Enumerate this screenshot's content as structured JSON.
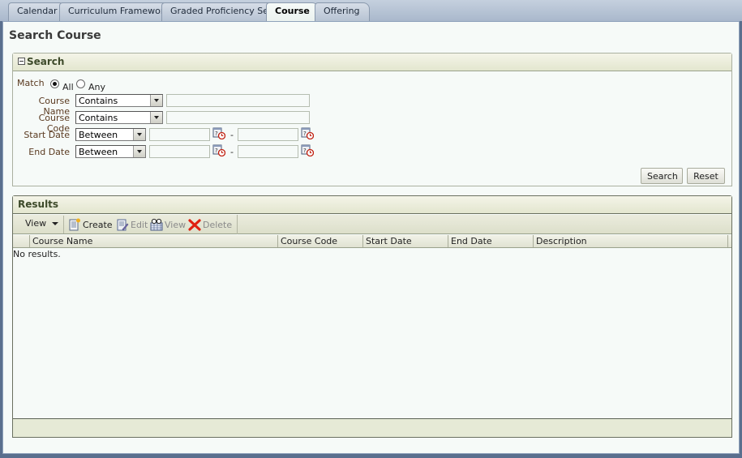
{
  "tabs": [
    {
      "label": "Calendar",
      "active": false
    },
    {
      "label": "Curriculum Framework",
      "active": false
    },
    {
      "label": "Graded Proficiency Set",
      "active": false
    },
    {
      "label": "Course",
      "active": true
    },
    {
      "label": "Offering",
      "active": false
    }
  ],
  "page_title": "Search Course",
  "search": {
    "header": "Search",
    "match_label": "Match",
    "match_options": [
      {
        "label": "All",
        "checked": true
      },
      {
        "label": "Any",
        "checked": false
      }
    ],
    "fields": [
      {
        "label": "Course Name",
        "operator": "Contains",
        "value": ""
      },
      {
        "label": "Course Code",
        "operator": "Contains",
        "value": ""
      },
      {
        "label": "Start Date",
        "operator": "Between",
        "from": "",
        "to": "",
        "separator": "-"
      },
      {
        "label": "End Date",
        "operator": "Between",
        "from": "",
        "to": "",
        "separator": "-"
      }
    ],
    "search_button": "Search",
    "reset_button": "Reset"
  },
  "results": {
    "header": "Results",
    "toolbar": {
      "view_menu": "View",
      "create": "Create",
      "edit": "Edit",
      "view": "View",
      "delete": "Delete"
    },
    "columns": [
      "Course Name",
      "Course Code",
      "Start Date",
      "End Date",
      "Description"
    ],
    "rows": [],
    "empty_message": "No results."
  },
  "colors": {
    "label_text": "#5a3a20",
    "header_text": "#3d4a2a",
    "page_bg": "#f6faf8",
    "tab_active_bg": "#f6faf8",
    "delete_icon": "#e02010"
  }
}
